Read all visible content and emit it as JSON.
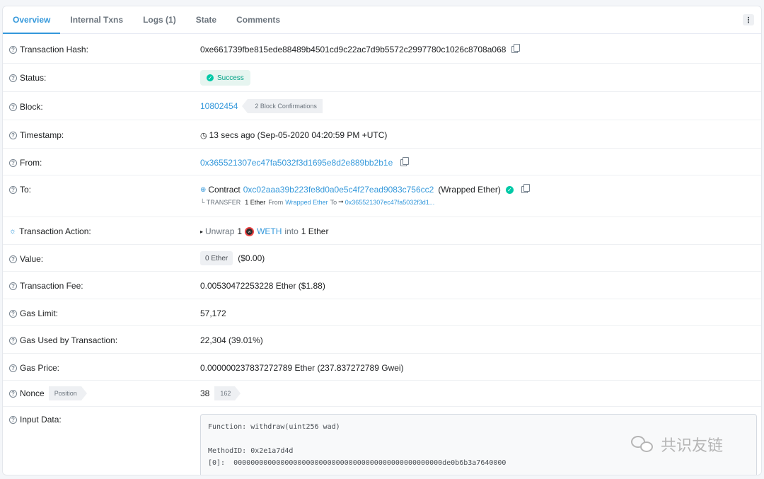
{
  "tabs": [
    {
      "label": "Overview"
    },
    {
      "label": "Internal Txns"
    },
    {
      "label": "Logs (1)"
    },
    {
      "label": "State"
    },
    {
      "label": "Comments"
    }
  ],
  "menu_glyph": "⋮",
  "rows": {
    "hash": {
      "label": "Transaction Hash:",
      "value": "0xe661739fbe815ede88489b4501cd9c22ac7d9b5572c2997780c1026c8708a068"
    },
    "status": {
      "label": "Status:",
      "value": "Success"
    },
    "block": {
      "label": "Block:",
      "value": "10802454",
      "confirmations": "2 Block Confirmations"
    },
    "timestamp": {
      "label": "Timestamp:",
      "value": "13 secs ago (Sep-05-2020 04:20:59 PM +UTC)"
    },
    "from": {
      "label": "From:",
      "value": "0x365521307ec47fa5032f3d1695e8d2e889bb2b1e"
    },
    "to": {
      "label": "To:",
      "prefix": "Contract",
      "address": "0xc02aaa39b223fe8d0a0e5c4f27ead9083c756cc2",
      "name": "(Wrapped Ether)",
      "transfer_prefix": "└ TRANSFER",
      "transfer_amount": "1 Ether",
      "transfer_from_word": "From",
      "transfer_from": "Wrapped Ether",
      "transfer_to_word": "To",
      "transfer_to": "0x365521307ec47fa5032f3d1..."
    },
    "action": {
      "label": "Transaction Action:",
      "verb": "Unwrap",
      "amount": "1",
      "token": "WETH",
      "into": "into",
      "result": "1 Ether"
    },
    "value": {
      "label": "Value:",
      "badge": "0 Ether",
      "usd": "($0.00)"
    },
    "fee": {
      "label": "Transaction Fee:",
      "value": "0.00530472253228 Ether ($1.88)"
    },
    "gas_limit": {
      "label": "Gas Limit:",
      "value": "57,172"
    },
    "gas_used": {
      "label": "Gas Used by Transaction:",
      "value": "22,304 (39.01%)"
    },
    "gas_price": {
      "label": "Gas Price:",
      "value": "0.000000237837272789 Ether (237.837272789 Gwei)"
    },
    "nonce": {
      "label": "Nonce",
      "position_tag": "Position",
      "value": "38",
      "position": "162"
    },
    "input": {
      "label": "Input Data:",
      "lines": [
        "Function: withdraw(uint256 wad)",
        "",
        "MethodID: 0x2e1a7d4d",
        "[0]:  0000000000000000000000000000000000000000000000000de0b6b3a7640000"
      ]
    }
  },
  "watermark": "共识友链",
  "colors": {
    "accent": "#3498db",
    "success": "#00c9a7",
    "text": "#1e2022",
    "muted": "#6c757e"
  }
}
